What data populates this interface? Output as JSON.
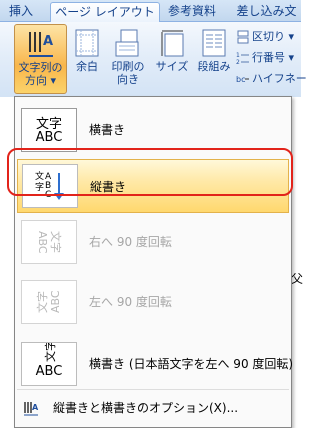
{
  "tabs": [
    {
      "label": "挿入"
    },
    {
      "label": "ページ レイアウト",
      "active": true
    },
    {
      "label": "参考資料"
    },
    {
      "label": "差し込み文"
    }
  ],
  "ribbon": {
    "text_direction": {
      "line1": "文字列の",
      "line2": "方向 ▾",
      "icon": "text-direction-icon"
    },
    "margins": {
      "label": "余白",
      "icon": "margins-icon"
    },
    "orientation": {
      "line1": "印刷の",
      "line2": "向き",
      "icon": "orientation-icon"
    },
    "size": {
      "label": "サイズ",
      "icon": "size-icon"
    },
    "columns": {
      "label": "段組み",
      "icon": "columns-icon"
    },
    "breaks": {
      "label": "区切り ▾",
      "icon": "breaks-icon"
    },
    "line_numbers": {
      "label": "行番号 ▾",
      "icon": "line-numbers-icon"
    },
    "hyphenation": {
      "label": "ハイフネー",
      "icon": "hyphenation-icon"
    }
  },
  "menu": {
    "items": [
      {
        "label": "横書き",
        "thumb_top": "文字",
        "thumb_bottom": "ABC",
        "state": "selected"
      },
      {
        "label": "縦書き",
        "state": "hover"
      },
      {
        "label": "右へ 90 度回転",
        "state": "disabled"
      },
      {
        "label": "左へ 90 度回転",
        "state": "disabled"
      },
      {
        "label": "横書き (日本語文字を左へ 90 度回転)",
        "thumb_top": "文字",
        "thumb_bottom": "ABC",
        "state": "normal"
      }
    ],
    "options_label": "縦書きと横書きのオプション(X)..."
  },
  "background": {
    "partial_text": "父"
  },
  "colors": {
    "accent": "#15428b",
    "hover_start": "#fff8d9",
    "hover_end": "#ffd86e",
    "highlight_outline": "#e2231a",
    "pressed": "#f8b64b"
  }
}
